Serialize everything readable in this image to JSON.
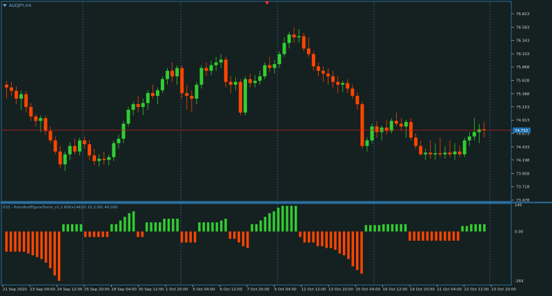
{
  "window": {
    "symbol_label": "AUDJPY,H4",
    "indicator_label": "033 - PointAndFigureTrend_v1.2 600+[44](0.10,2.00) 40.000"
  },
  "colors": {
    "background": "#152020",
    "bull": "#32cd32",
    "bear": "#ff4500",
    "grid": "#2a6fa0",
    "price_line": "#c81e1e",
    "text": "#6aa8d8",
    "axis_text": "#d0d0d0"
  },
  "icons": {
    "collapse": "triangle-down-icon",
    "scroll_marker": "triangle-down-icon"
  },
  "chart_data": [
    {
      "type": "candlestick",
      "title": "AUDJPY,H4",
      "y_ticks": [
        "76.823",
        "76.583",
        "76.343",
        "76.103",
        "75.868",
        "75.628",
        "75.388",
        "75.153",
        "74.913",
        "74.673",
        "74.433",
        "74.198",
        "73.958",
        "73.718",
        "73.478"
      ],
      "ylim": [
        73.478,
        76.823
      ],
      "current_price_label": "74.732",
      "current_price": 74.732,
      "x_labels": [
        "21 Sep 2020",
        "23 Sep 04:00",
        "24 Sep 12:00",
        "25 Sep 20:00",
        "29 Sep 04:00",
        "30 Sep 12:00",
        "1 Oct 20:00",
        "5 Oct 04:00",
        "6 Oct 12:00",
        "7 Oct 20:00",
        "9 Oct 04:00",
        "12 Oct 12:00",
        "13 Oct 20:00",
        "15 Oct 04:00",
        "16 Oct 12:00",
        "19 Oct 20:00",
        "21 Oct 04:00",
        "22 Oct 12:00",
        "23 Oct 20:00"
      ],
      "candles": [
        {
          "o": 75.55,
          "h": 75.62,
          "l": 75.3,
          "c": 75.5
        },
        {
          "o": 75.5,
          "h": 75.6,
          "l": 75.35,
          "c": 75.44
        },
        {
          "o": 75.44,
          "h": 75.52,
          "l": 75.2,
          "c": 75.3
        },
        {
          "o": 75.3,
          "h": 75.45,
          "l": 75.1,
          "c": 75.38
        },
        {
          "o": 75.38,
          "h": 75.44,
          "l": 75.05,
          "c": 75.15
        },
        {
          "o": 75.15,
          "h": 75.22,
          "l": 74.9,
          "c": 74.98
        },
        {
          "o": 74.98,
          "h": 75.02,
          "l": 74.8,
          "c": 74.9
        },
        {
          "o": 74.9,
          "h": 75.0,
          "l": 74.7,
          "c": 74.95
        },
        {
          "o": 74.95,
          "h": 75.0,
          "l": 74.65,
          "c": 74.72
        },
        {
          "o": 74.72,
          "h": 74.8,
          "l": 74.5,
          "c": 74.55
        },
        {
          "o": 74.55,
          "h": 74.62,
          "l": 74.3,
          "c": 74.35
        },
        {
          "o": 74.35,
          "h": 74.45,
          "l": 74.05,
          "c": 74.12
        },
        {
          "o": 74.12,
          "h": 74.35,
          "l": 74.0,
          "c": 74.3
        },
        {
          "o": 74.3,
          "h": 74.52,
          "l": 74.2,
          "c": 74.45
        },
        {
          "o": 74.45,
          "h": 74.58,
          "l": 74.3,
          "c": 74.35
        },
        {
          "o": 74.35,
          "h": 74.6,
          "l": 74.28,
          "c": 74.55
        },
        {
          "o": 74.55,
          "h": 74.62,
          "l": 74.4,
          "c": 74.48
        },
        {
          "o": 74.48,
          "h": 74.55,
          "l": 74.2,
          "c": 74.28
        },
        {
          "o": 74.28,
          "h": 74.4,
          "l": 74.1,
          "c": 74.18
        },
        {
          "o": 74.18,
          "h": 74.3,
          "l": 74.08,
          "c": 74.22
        },
        {
          "o": 74.22,
          "h": 74.35,
          "l": 74.12,
          "c": 74.2
        },
        {
          "o": 74.2,
          "h": 74.3,
          "l": 74.1,
          "c": 74.25
        },
        {
          "o": 74.25,
          "h": 74.55,
          "l": 74.18,
          "c": 74.5
        },
        {
          "o": 74.5,
          "h": 74.65,
          "l": 74.4,
          "c": 74.58
        },
        {
          "o": 74.58,
          "h": 74.9,
          "l": 74.5,
          "c": 74.85
        },
        {
          "o": 74.85,
          "h": 75.15,
          "l": 74.8,
          "c": 75.1
        },
        {
          "o": 75.1,
          "h": 75.25,
          "l": 75.0,
          "c": 75.2
        },
        {
          "o": 75.2,
          "h": 75.35,
          "l": 75.05,
          "c": 75.15
        },
        {
          "o": 75.15,
          "h": 75.3,
          "l": 75.0,
          "c": 75.22
        },
        {
          "o": 75.22,
          "h": 75.45,
          "l": 75.1,
          "c": 75.4
        },
        {
          "o": 75.4,
          "h": 75.55,
          "l": 75.3,
          "c": 75.35
        },
        {
          "o": 75.35,
          "h": 75.5,
          "l": 75.2,
          "c": 75.45
        },
        {
          "o": 75.45,
          "h": 75.7,
          "l": 75.4,
          "c": 75.65
        },
        {
          "o": 75.65,
          "h": 75.85,
          "l": 75.55,
          "c": 75.8
        },
        {
          "o": 75.8,
          "h": 75.95,
          "l": 75.6,
          "c": 75.7
        },
        {
          "o": 75.7,
          "h": 75.9,
          "l": 75.55,
          "c": 75.85
        },
        {
          "o": 75.85,
          "h": 75.9,
          "l": 75.3,
          "c": 75.4
        },
        {
          "o": 75.4,
          "h": 75.55,
          "l": 75.1,
          "c": 75.35
        },
        {
          "o": 75.35,
          "h": 75.45,
          "l": 75.05,
          "c": 75.3
        },
        {
          "o": 75.3,
          "h": 75.6,
          "l": 75.2,
          "c": 75.55
        },
        {
          "o": 75.55,
          "h": 75.9,
          "l": 75.48,
          "c": 75.85
        },
        {
          "o": 75.85,
          "h": 75.95,
          "l": 75.7,
          "c": 75.8
        },
        {
          "o": 75.8,
          "h": 75.98,
          "l": 75.72,
          "c": 75.9
        },
        {
          "o": 75.9,
          "h": 76.05,
          "l": 75.8,
          "c": 75.95
        },
        {
          "o": 75.95,
          "h": 76.1,
          "l": 75.85,
          "c": 76.0
        },
        {
          "o": 76.0,
          "h": 76.05,
          "l": 75.5,
          "c": 75.6
        },
        {
          "o": 75.6,
          "h": 75.7,
          "l": 75.4,
          "c": 75.55
        },
        {
          "o": 75.55,
          "h": 75.68,
          "l": 75.45,
          "c": 75.6
        },
        {
          "o": 75.6,
          "h": 75.65,
          "l": 75.0,
          "c": 75.05
        },
        {
          "o": 75.05,
          "h": 75.7,
          "l": 75.0,
          "c": 75.65
        },
        {
          "o": 75.65,
          "h": 75.75,
          "l": 75.5,
          "c": 75.58
        },
        {
          "o": 75.58,
          "h": 75.72,
          "l": 75.5,
          "c": 75.62
        },
        {
          "o": 75.62,
          "h": 75.8,
          "l": 75.55,
          "c": 75.7
        },
        {
          "o": 75.7,
          "h": 75.95,
          "l": 75.65,
          "c": 75.9
        },
        {
          "o": 75.9,
          "h": 76.05,
          "l": 75.78,
          "c": 75.85
        },
        {
          "o": 75.85,
          "h": 76.0,
          "l": 75.75,
          "c": 75.92
        },
        {
          "o": 75.92,
          "h": 76.15,
          "l": 75.85,
          "c": 76.1
        },
        {
          "o": 76.1,
          "h": 76.4,
          "l": 76.05,
          "c": 76.3
        },
        {
          "o": 76.3,
          "h": 76.5,
          "l": 76.2,
          "c": 76.45
        },
        {
          "o": 76.45,
          "h": 76.58,
          "l": 76.3,
          "c": 76.4
        },
        {
          "o": 76.4,
          "h": 76.55,
          "l": 76.3,
          "c": 76.42
        },
        {
          "o": 76.42,
          "h": 76.48,
          "l": 76.15,
          "c": 76.2
        },
        {
          "o": 76.2,
          "h": 76.4,
          "l": 76.05,
          "c": 76.1
        },
        {
          "o": 76.1,
          "h": 76.15,
          "l": 75.8,
          "c": 75.88
        },
        {
          "o": 75.88,
          "h": 75.95,
          "l": 75.7,
          "c": 75.8
        },
        {
          "o": 75.8,
          "h": 75.88,
          "l": 75.6,
          "c": 75.75
        },
        {
          "o": 75.75,
          "h": 75.85,
          "l": 75.55,
          "c": 75.7
        },
        {
          "o": 75.7,
          "h": 75.8,
          "l": 75.5,
          "c": 75.6
        },
        {
          "o": 75.6,
          "h": 75.7,
          "l": 75.4,
          "c": 75.55
        },
        {
          "o": 75.55,
          "h": 75.62,
          "l": 75.42,
          "c": 75.58
        },
        {
          "o": 75.58,
          "h": 75.65,
          "l": 75.4,
          "c": 75.48
        },
        {
          "o": 75.48,
          "h": 75.55,
          "l": 75.3,
          "c": 75.35
        },
        {
          "o": 75.35,
          "h": 75.42,
          "l": 75.1,
          "c": 75.2
        },
        {
          "o": 75.2,
          "h": 75.25,
          "l": 74.4,
          "c": 74.45
        },
        {
          "o": 74.45,
          "h": 74.6,
          "l": 74.35,
          "c": 74.55
        },
        {
          "o": 74.55,
          "h": 74.85,
          "l": 74.5,
          "c": 74.8
        },
        {
          "o": 74.8,
          "h": 74.9,
          "l": 74.6,
          "c": 74.7
        },
        {
          "o": 74.7,
          "h": 74.82,
          "l": 74.55,
          "c": 74.78
        },
        {
          "o": 74.78,
          "h": 74.92,
          "l": 74.65,
          "c": 74.72
        },
        {
          "o": 74.72,
          "h": 74.95,
          "l": 74.68,
          "c": 74.9
        },
        {
          "o": 74.9,
          "h": 75.05,
          "l": 74.8,
          "c": 74.85
        },
        {
          "o": 74.85,
          "h": 74.95,
          "l": 74.72,
          "c": 74.8
        },
        {
          "o": 74.8,
          "h": 74.92,
          "l": 74.6,
          "c": 74.88
        },
        {
          "o": 74.88,
          "h": 74.95,
          "l": 74.55,
          "c": 74.6
        },
        {
          "o": 74.6,
          "h": 74.68,
          "l": 74.4,
          "c": 74.45
        },
        {
          "o": 74.45,
          "h": 74.55,
          "l": 74.28,
          "c": 74.3
        },
        {
          "o": 74.3,
          "h": 74.4,
          "l": 74.2,
          "c": 74.33
        },
        {
          "o": 74.33,
          "h": 74.55,
          "l": 74.22,
          "c": 74.3
        },
        {
          "o": 74.3,
          "h": 74.5,
          "l": 74.2,
          "c": 74.32
        },
        {
          "o": 74.32,
          "h": 74.6,
          "l": 74.25,
          "c": 74.3
        },
        {
          "o": 74.3,
          "h": 74.45,
          "l": 74.22,
          "c": 74.33
        },
        {
          "o": 74.33,
          "h": 74.55,
          "l": 74.25,
          "c": 74.3
        },
        {
          "o": 74.3,
          "h": 74.5,
          "l": 74.2,
          "c": 74.35
        },
        {
          "o": 74.35,
          "h": 74.45,
          "l": 74.25,
          "c": 74.3
        },
        {
          "o": 74.3,
          "h": 74.6,
          "l": 74.25,
          "c": 74.55
        },
        {
          "o": 74.55,
          "h": 74.7,
          "l": 74.45,
          "c": 74.62
        },
        {
          "o": 74.62,
          "h": 74.95,
          "l": 74.55,
          "c": 74.7
        },
        {
          "o": 74.7,
          "h": 74.85,
          "l": 74.5,
          "c": 74.75
        },
        {
          "o": 74.75,
          "h": 74.88,
          "l": 74.6,
          "c": 74.73
        }
      ]
    },
    {
      "type": "bar",
      "title": "033 - PointAndFigureTrend_v1.2 600+[44](0.10,2.00) 40.000",
      "y_ticks": [
        "145",
        "0.00",
        "-269"
      ],
      "ylim": [
        -269,
        145
      ],
      "values": [
        -110,
        -110,
        -110,
        -110,
        -110,
        -120,
        -130,
        -140,
        -150,
        -170,
        -200,
        -240,
        -269,
        40,
        40,
        40,
        40,
        40,
        -30,
        -30,
        -30,
        -30,
        -30,
        -30,
        40,
        40,
        60,
        80,
        100,
        110,
        -30,
        -30,
        50,
        50,
        50,
        50,
        70,
        70,
        70,
        70,
        -60,
        -60,
        -60,
        -60,
        50,
        50,
        50,
        50,
        50,
        60,
        70,
        -40,
        -40,
        -60,
        -80,
        -90,
        40,
        40,
        60,
        80,
        100,
        110,
        130,
        140,
        140,
        140,
        140,
        -30,
        -60,
        -60,
        -60,
        -80,
        -80,
        -90,
        -90,
        -100,
        -120,
        -130,
        -150,
        -190,
        -210,
        -230,
        35,
        35,
        35,
        35,
        40,
        40,
        40,
        40,
        40,
        40,
        -50,
        -50,
        -50,
        -50,
        -50,
        -50,
        -50,
        -50,
        -50,
        -50,
        -50,
        -50,
        30,
        30,
        40,
        40,
        40,
        40
      ]
    }
  ]
}
